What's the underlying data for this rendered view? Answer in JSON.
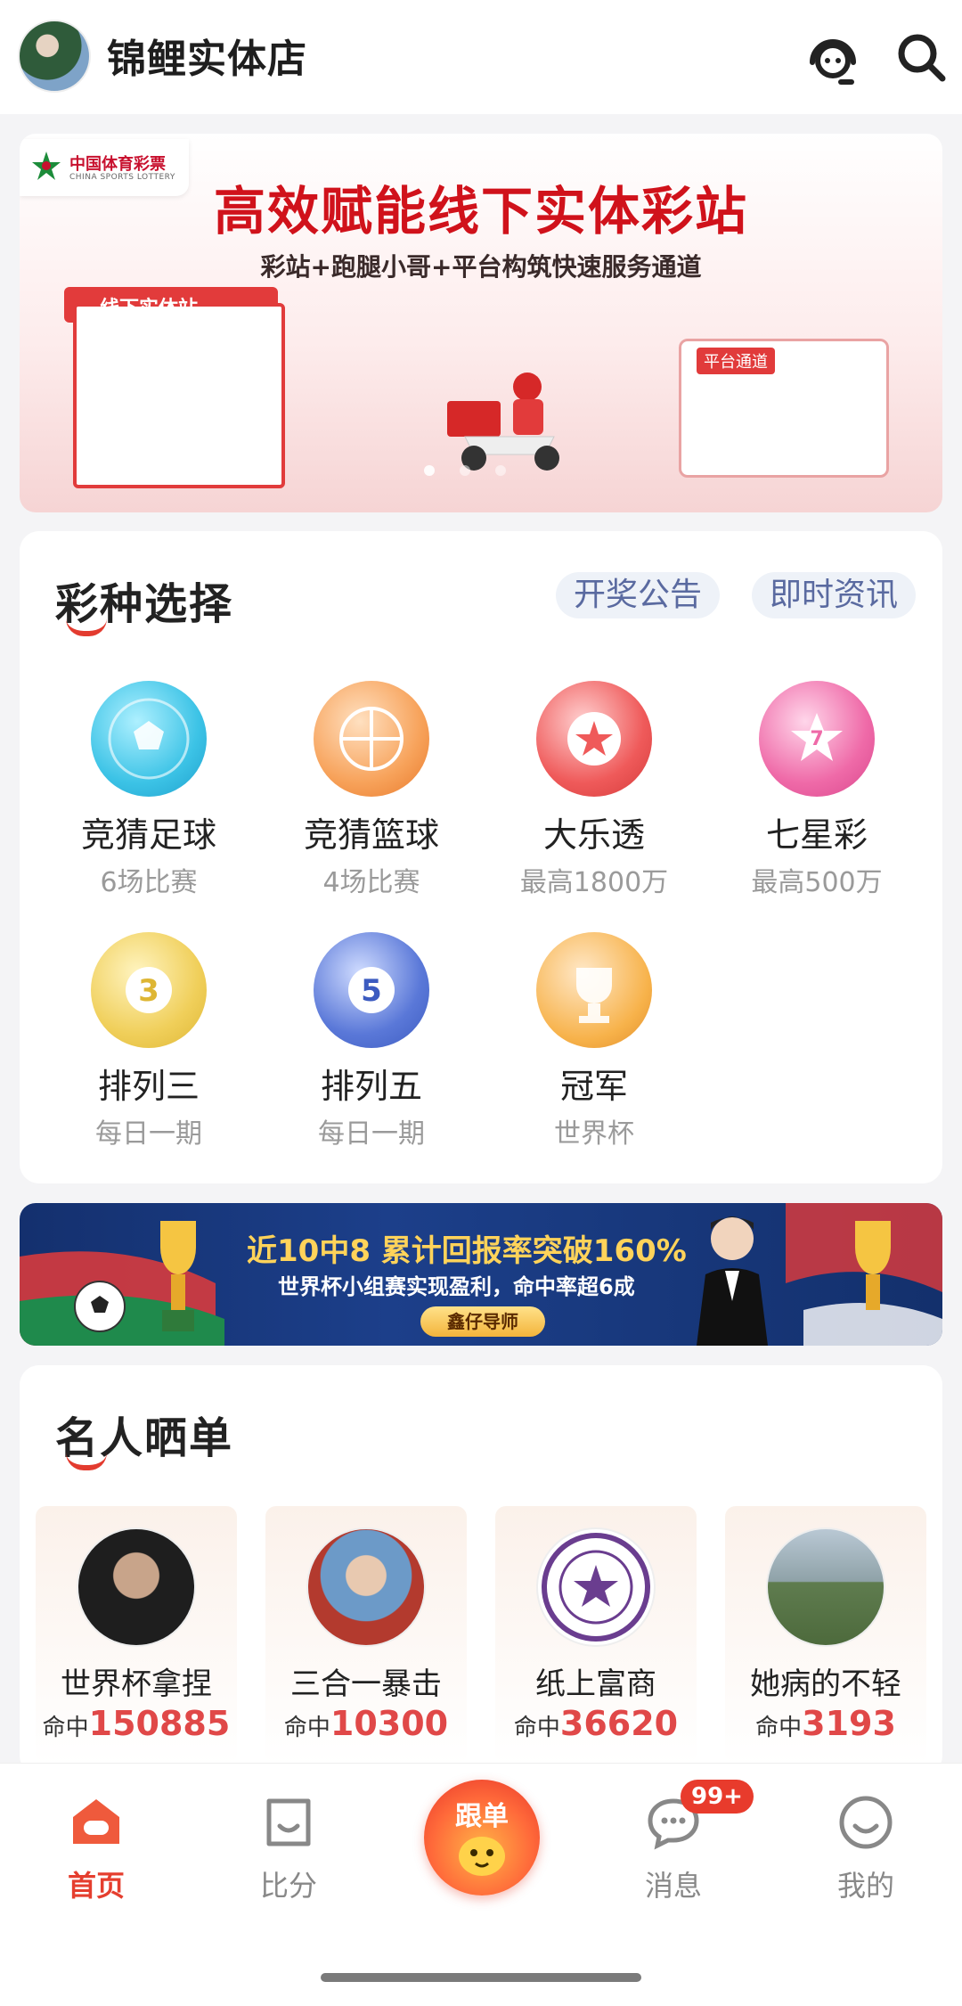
{
  "header": {
    "store_name": "锦鲤实体店",
    "icons": [
      "customer-service-icon",
      "search-icon"
    ]
  },
  "banner_top": {
    "logo_text": "中国体育彩票",
    "logo_sub": "CHINA SPORTS LOTTERY",
    "title": "高效赋能线下实体彩站",
    "subtitle": "彩站+跑腿小哥+平台构筑快速服务通道",
    "kiosk_label": "线下实体站",
    "platform_label": "平台通道"
  },
  "lottery_section": {
    "title": "彩种选择",
    "links": [
      "开奖公告",
      "即时资讯"
    ],
    "items": [
      {
        "name": "竞猜足球",
        "desc": "6场比赛",
        "icon": "soccer-ball-icon",
        "color": "#3cc3e6"
      },
      {
        "name": "竞猜篮球",
        "desc": "4场比赛",
        "icon": "basketball-icon",
        "color": "#f7a25a"
      },
      {
        "name": "大乐透",
        "desc": "最高1800万",
        "icon": "star-ball-icon",
        "color": "#ef5a5a"
      },
      {
        "name": "七星彩",
        "desc": "最高500万",
        "icon": "seven-star-icon",
        "color": "#ef6aa8"
      },
      {
        "name": "排列三",
        "desc": "每日一期",
        "icon": "number-3-ball-icon",
        "color": "#f0cf5a"
      },
      {
        "name": "排列五",
        "desc": "每日一期",
        "icon": "number-5-ball-icon",
        "color": "#5a78d8"
      },
      {
        "name": "冠军",
        "desc": "世界杯",
        "icon": "world-cup-trophy-icon",
        "color": "#f7b24a"
      }
    ]
  },
  "banner_mid": {
    "headline": "近10中8 累计回报率突破160%",
    "sub": "世界杯小组赛实现盈利，命中率超6成",
    "button": "鑫仔导师"
  },
  "celebrity_section": {
    "title": "名人晒单",
    "hit_label": "命中",
    "items": [
      {
        "name": "世界杯拿捏",
        "hits": "150885"
      },
      {
        "name": "三合一暴击",
        "hits": "10300"
      },
      {
        "name": "纸上富商",
        "hits": "36620"
      },
      {
        "name": "她病的不轻",
        "hits": "3193"
      }
    ]
  },
  "bottom_nav": {
    "items": [
      {
        "label": "首页",
        "icon": "home-icon",
        "active": true
      },
      {
        "label": "比分",
        "icon": "score-icon",
        "active": false
      },
      {
        "label": "跟单",
        "icon": "follow-order-icon",
        "active": false
      },
      {
        "label": "消息",
        "icon": "message-icon",
        "active": false
      },
      {
        "label": "我的",
        "icon": "profile-icon",
        "active": false
      }
    ],
    "message_badge": "99+"
  },
  "colors": {
    "accent": "#e53e2e",
    "link_pill_text": "#5a6aa0",
    "hit_number": "#e04848"
  }
}
